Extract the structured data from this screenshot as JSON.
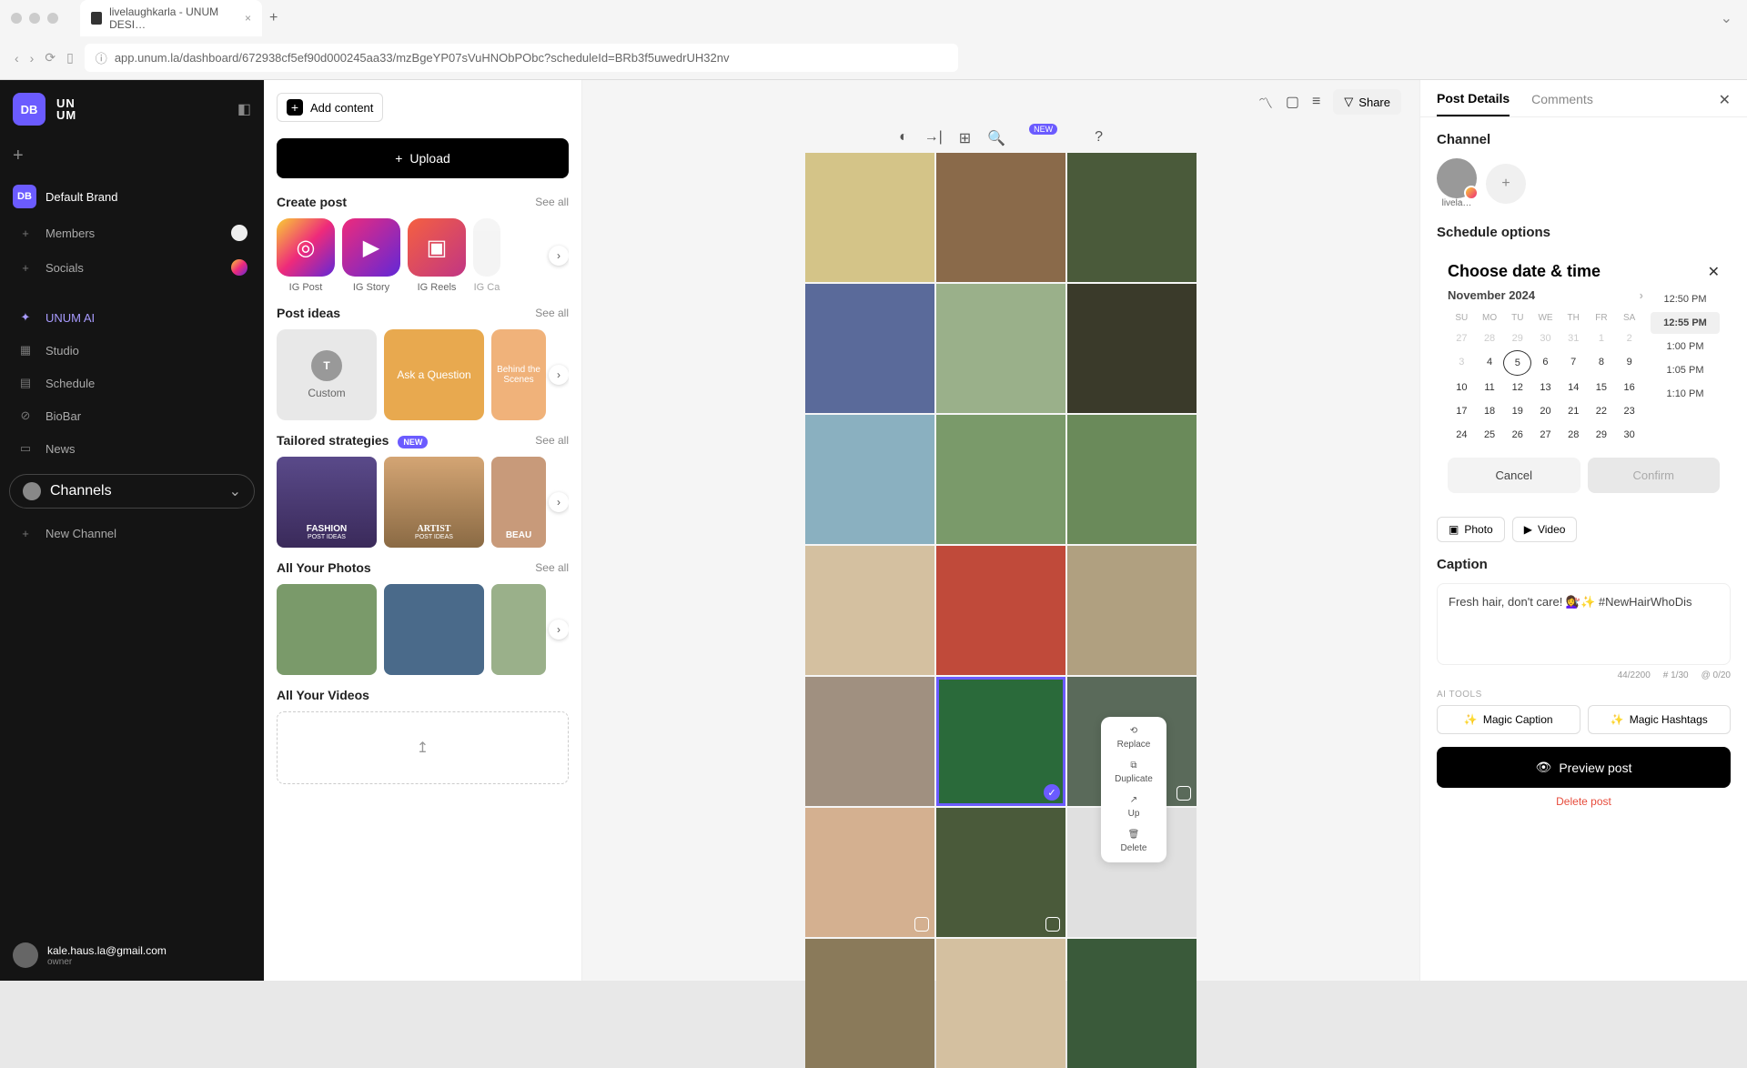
{
  "browser": {
    "tab_title": "livelaughkarla - UNUM DESI…",
    "url": "app.unum.la/dashboard/672938cf5ef90d000245aa33/mzBgeYP07sVuHNObPObc?scheduleId=BRb3f5uwedrUH32nv"
  },
  "sidebar": {
    "user_badge": "DB",
    "logo_line1": "UN",
    "logo_line2": "UM",
    "brand": {
      "initials": "DB",
      "name": "Default Brand"
    },
    "members": "Members",
    "socials": "Socials",
    "unum_ai": "UNUM AI",
    "studio": "Studio",
    "schedule": "Schedule",
    "biobar": "BioBar",
    "news": "News",
    "channels": "Channels",
    "new_channel": "New Channel",
    "user_email": "kale.haus.la@gmail.com",
    "user_role": "owner"
  },
  "content": {
    "add_content": "Add content",
    "upload": "Upload",
    "create_post": "Create post",
    "see_all": "See all",
    "post_types": {
      "ig_post": "IG Post",
      "ig_story": "IG Story",
      "ig_reels": "IG Reels",
      "ig_carousel": "IG Ca"
    },
    "post_ideas": {
      "title": "Post ideas",
      "custom": "Custom",
      "ask": "Ask a Question",
      "behind": "Behind the Scenes"
    },
    "strategies": {
      "title": "Tailored strategies",
      "new_badge": "NEW",
      "fashion": "FASHION",
      "fashion_sub": "POST IDEAS",
      "artist": "ARTIST",
      "artist_sub": "POST IDEAS",
      "beauty": "BEAU"
    },
    "photos_title": "All Your Photos",
    "videos_title": "All Your Videos"
  },
  "canvas": {
    "share": "Share",
    "new_tag": "NEW",
    "actions": {
      "replace": "Replace",
      "duplicate": "Duplicate",
      "up": "Up",
      "delete": "Delete"
    }
  },
  "panel": {
    "tabs": {
      "details": "Post Details",
      "comments": "Comments"
    },
    "channel_title": "Channel",
    "channel_label": "livela…",
    "schedule_title": "Schedule options",
    "datetime": {
      "title": "Choose date & time",
      "month": "November 2024",
      "dow": [
        "SU",
        "MO",
        "TU",
        "WE",
        "TH",
        "FR",
        "SA"
      ],
      "prev_days": [
        "27",
        "28",
        "29",
        "30",
        "31",
        "1",
        "2"
      ],
      "weeks": [
        [
          "3",
          "4",
          "5",
          "6",
          "7",
          "8",
          "9"
        ],
        [
          "10",
          "11",
          "12",
          "13",
          "14",
          "15",
          "16"
        ],
        [
          "17",
          "18",
          "19",
          "20",
          "21",
          "22",
          "23"
        ],
        [
          "24",
          "25",
          "26",
          "27",
          "28",
          "29",
          "30"
        ]
      ],
      "selected_day": "5",
      "times": [
        "12:50 PM",
        "12:55 PM",
        "1:00 PM",
        "1:05 PM",
        "1:10 PM"
      ],
      "selected_time": "12:55 PM",
      "cancel": "Cancel",
      "confirm": "Confirm"
    },
    "media": {
      "photo": "Photo",
      "video": "Video"
    },
    "caption_title": "Caption",
    "caption_text": "Fresh hair, don't care! 💇‍♀️✨ #NewHairWhoDis",
    "caption_count": "44/2200",
    "hashtag_count": "# 1/30",
    "mention_count": "@ 0/20",
    "ai_label": "AI TOOLS",
    "magic_caption": "Magic Caption",
    "magic_hashtags": "Magic Hashtags",
    "preview": "Preview post",
    "delete": "Delete post"
  }
}
